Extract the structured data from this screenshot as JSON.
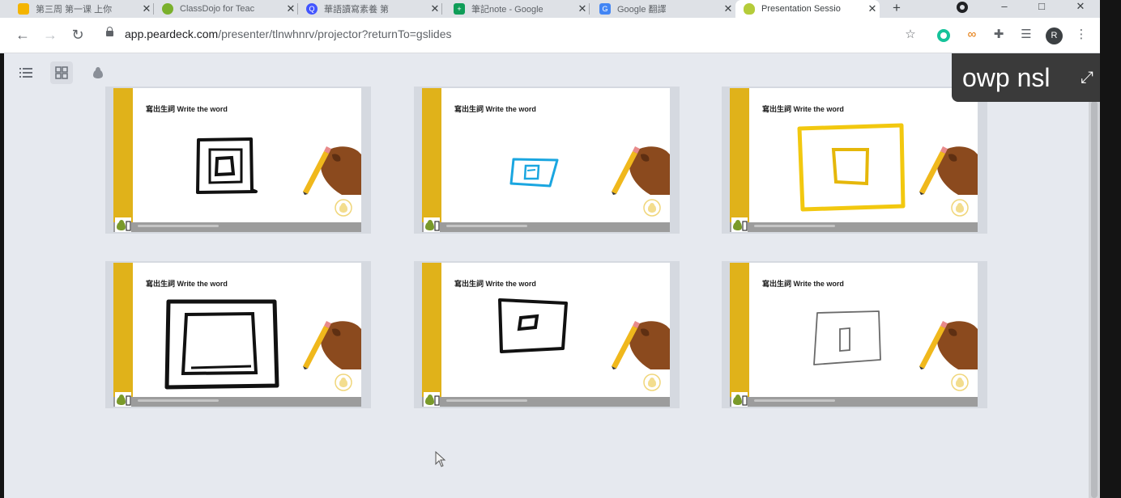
{
  "tabs": [
    {
      "title": "第三周 第一课 上你",
      "favicon": "slides-icon",
      "color": "#f4b400"
    },
    {
      "title": "ClassDojo for Teac",
      "favicon": "classdojo-icon",
      "color": "#7ab02c"
    },
    {
      "title": "華語讀寫素養 第",
      "favicon": "quizlet-icon",
      "color": "#4255ff"
    },
    {
      "title": "筆記note - Google",
      "favicon": "sheets-icon",
      "color": "#0f9d58"
    },
    {
      "title": "Google 翻譯",
      "favicon": "translate-icon",
      "color": "#4285f4"
    },
    {
      "title": "Presentation Sessio",
      "favicon": "peardeck-icon",
      "color": "#b5cc3a",
      "active": true
    }
  ],
  "toolbar": {
    "url_domain": "app.peardeck.com",
    "url_path": "/presenter/tlnwhnrv/projector?returnTo=gslides",
    "avatar_letter": "R"
  },
  "slides": [
    {
      "title": "寫出生詞 Write the word",
      "drawing": "black-square-small"
    },
    {
      "title": "寫出生詞 Write the word",
      "drawing": "blue-quad"
    },
    {
      "title": "寫出生詞 Write the word",
      "drawing": "yellow-square"
    },
    {
      "title": "寫出生詞 Write the word",
      "drawing": "black-square-large"
    },
    {
      "title": "寫出生詞 Write the word",
      "drawing": "black-square-medium"
    },
    {
      "title": "寫出生詞 Write the word",
      "drawing": "gray-thin-square"
    }
  ],
  "overlay": {
    "text": "owp nsl",
    "icon": "expand-icon"
  },
  "colors": {
    "accent_stripe": "#e0b21a",
    "background": "#e6e9ef"
  }
}
